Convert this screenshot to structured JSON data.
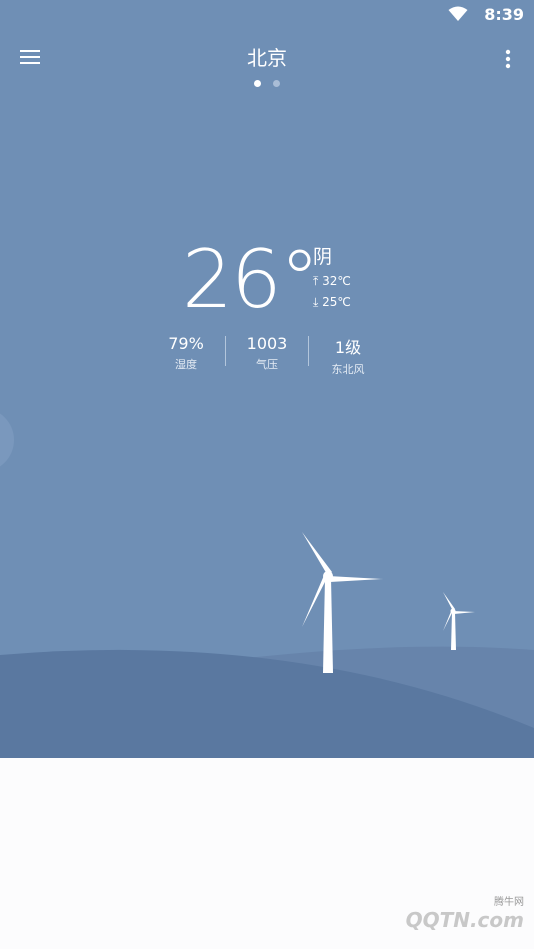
{
  "status_bar": {
    "time": "8:39",
    "wifi_icon": "wifi-icon"
  },
  "header": {
    "city": "北京",
    "pages": 2,
    "active_page": 1
  },
  "current": {
    "temperature": "26°",
    "condition": "阴",
    "high": "32℃",
    "low": "25℃",
    "high_prefix": "⤒",
    "low_prefix": "⤓"
  },
  "stats": [
    {
      "value": "79%",
      "label": "湿度"
    },
    {
      "value": "1003",
      "label": "气压"
    },
    {
      "value": "1级",
      "label": "东北风"
    }
  ],
  "watermark": {
    "brand": "QQTN.com",
    "sub": "腾牛网"
  },
  "colors": {
    "sky": "#6f8fb5",
    "hill_back": "#6784ab",
    "hill_front": "#5a78a0",
    "bottom": "#fcfcfd"
  }
}
